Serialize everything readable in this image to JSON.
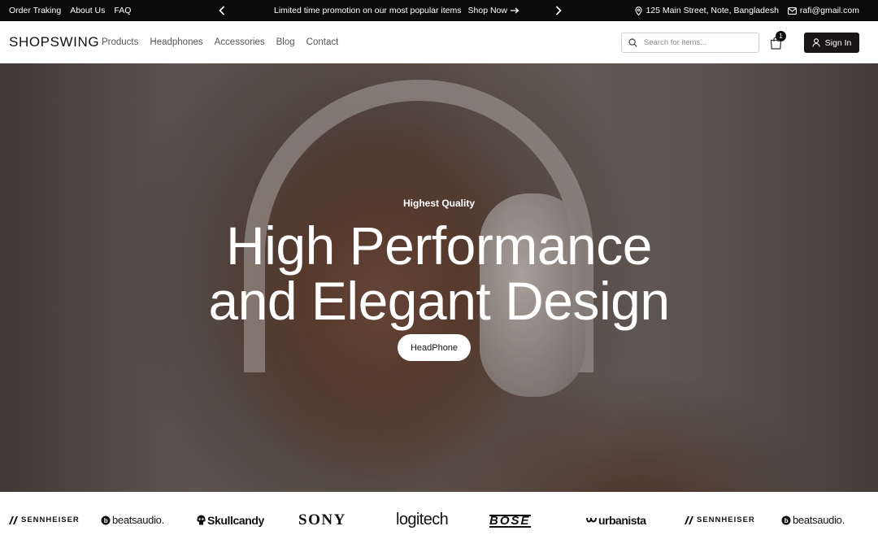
{
  "topbar": {
    "links": [
      "Order Traking",
      "About Us",
      "FAQ"
    ],
    "promo_text": "Limited time promotion on our most popular items",
    "shop_now": "Shop Now",
    "address": "125 Main Street, Note, Bangladesh",
    "email": "rafi@gmail.com"
  },
  "header": {
    "logo": "SHOPSWING",
    "nav": [
      "Products",
      "Headphones",
      "Accessories",
      "Blog",
      "Contact"
    ],
    "search_placeholder": "Search for items...",
    "cart_count": "1",
    "signin_label": "Sign In"
  },
  "hero": {
    "eyebrow": "Highest Quality",
    "title_line1": "High Performance",
    "title_line2": "and Elegant Design",
    "cta_label": "HeadPhone"
  },
  "brands": [
    "SENNHEISER",
    "beatsaudio.",
    "Skullcandy",
    "SONY",
    "logitech",
    "BOSE",
    "urbanista",
    "SENNHEISER",
    "beatsaudio."
  ],
  "colors": {
    "topbar_bg": "#0b0b0b",
    "signin_bg": "#1a1516",
    "cta_bg": "#ffffff"
  },
  "icons": [
    "chevron-left-icon",
    "chevron-right-icon",
    "arrow-right-icon",
    "location-pin-icon",
    "mail-icon",
    "search-icon",
    "shopping-bag-icon",
    "user-icon"
  ]
}
